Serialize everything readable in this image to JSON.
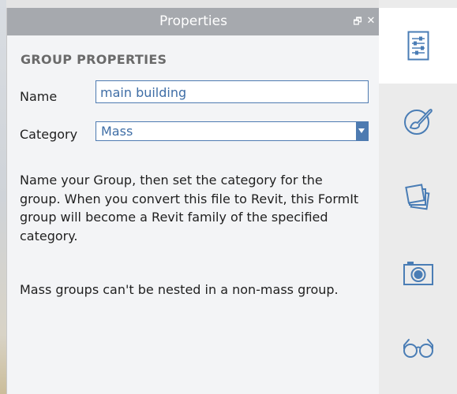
{
  "panel": {
    "title": "Properties",
    "restore_glyph": "🗗",
    "close_glyph": "✕"
  },
  "group_properties": {
    "heading": "GROUP PROPERTIES",
    "name_label": "Name",
    "name_value": "main building",
    "category_label": "Category",
    "category_value": "Mass",
    "description": "Name your Group, then set the category for the group. When you convert this file to Revit, this FormIt group will become a Revit family of the specified category.",
    "note": "Mass groups can't be nested in a non-mass group."
  },
  "toolbar": {
    "active_tool": "properties",
    "icon_color": "#4a7db5",
    "tools": [
      {
        "id": "properties",
        "icon": "properties-list-icon"
      },
      {
        "id": "materials",
        "icon": "paint-palette-icon"
      },
      {
        "id": "layers",
        "icon": "layers-stack-icon"
      },
      {
        "id": "scenes",
        "icon": "camera-icon"
      },
      {
        "id": "visual-styles",
        "icon": "glasses-icon"
      }
    ]
  },
  "colors": {
    "titlebar": "#a6a9ae",
    "panel_bg": "#f3f4f6",
    "accent": "#4e7bb1",
    "heading_text": "#6a6a6a"
  }
}
